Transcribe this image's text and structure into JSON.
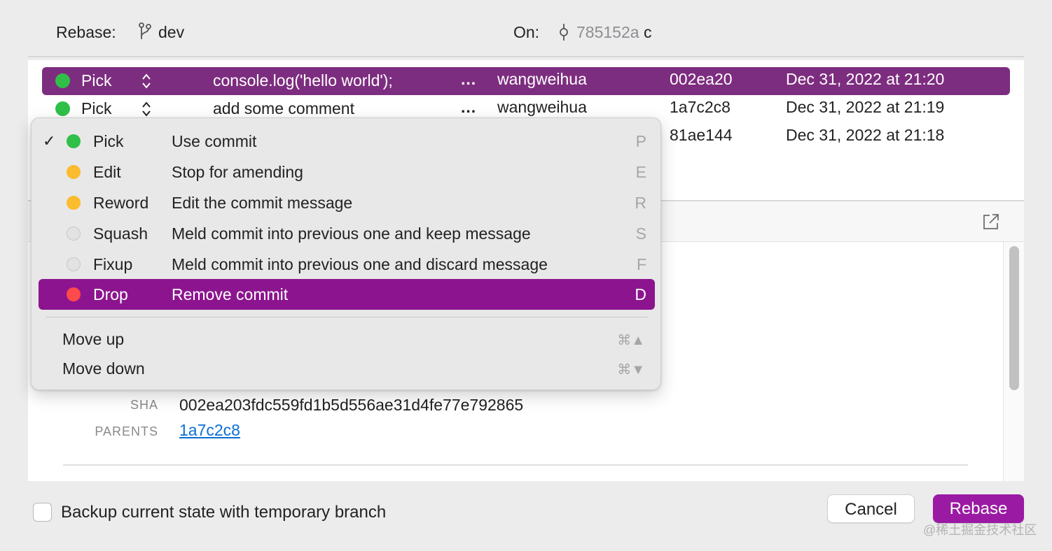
{
  "header": {
    "rebase_label": "Rebase:",
    "branch_name": "dev",
    "on_label": "On:",
    "on_sha": "785152a",
    "on_suffix": "c"
  },
  "commits": [
    {
      "action": "Pick",
      "message": "console.log('hello world');",
      "ellipsis": "...",
      "author": "wangweihua",
      "sha": "002ea20",
      "date": "Dec 31, 2022 at 21:20",
      "dot_color": "#30c048"
    },
    {
      "action": "Pick",
      "message": "add some comment",
      "ellipsis": "...",
      "author": "wangweihua",
      "sha": "1a7c2c8",
      "date": "Dec 31, 2022 at 21:19",
      "dot_color": "#30c048"
    },
    {
      "sha": "81ae144",
      "date": "Dec 31, 2022 at 21:18"
    }
  ],
  "menu": {
    "items": [
      {
        "name": "Pick",
        "desc": "Use commit",
        "key": "P",
        "check": "✓",
        "dot_color": "#30c048"
      },
      {
        "name": "Edit",
        "desc": "Stop for amending",
        "key": "E",
        "dot_color": "#fbbc2e"
      },
      {
        "name": "Reword",
        "desc": "Edit the commit message",
        "key": "R",
        "dot_color": "#fbbc2e"
      },
      {
        "name": "Squash",
        "desc": "Meld commit into previous one and keep message",
        "key": "S",
        "dot_color": "#e2e2e2"
      },
      {
        "name": "Fixup",
        "desc": "Meld commit into previous one and discard message",
        "key": "F",
        "dot_color": "#e2e2e2"
      },
      {
        "name": "Drop",
        "desc": "Remove commit",
        "key": "D",
        "dot_color": "#ff4b4b"
      }
    ],
    "move_up": "Move up",
    "move_up_shortcut": "⌘▲",
    "move_down": "Move down",
    "move_down_shortcut": "⌘▼"
  },
  "details": {
    "sha_label": "SHA",
    "sha_value": "002ea203fdc559fd1b5d556ae31d4fe77e792865",
    "parents_label": "PARENTS",
    "parents_value": "1a7c2c8"
  },
  "footer": {
    "backup_label": "Backup current state with temporary branch",
    "cancel": "Cancel",
    "rebase": "Rebase"
  },
  "watermark": "@稀土掘金技术社区",
  "colors": {
    "selection": "#7d2d7f",
    "menu_highlight": "#8c158f",
    "accent_button": "#9b1aa4",
    "link": "#0a6fd6"
  }
}
